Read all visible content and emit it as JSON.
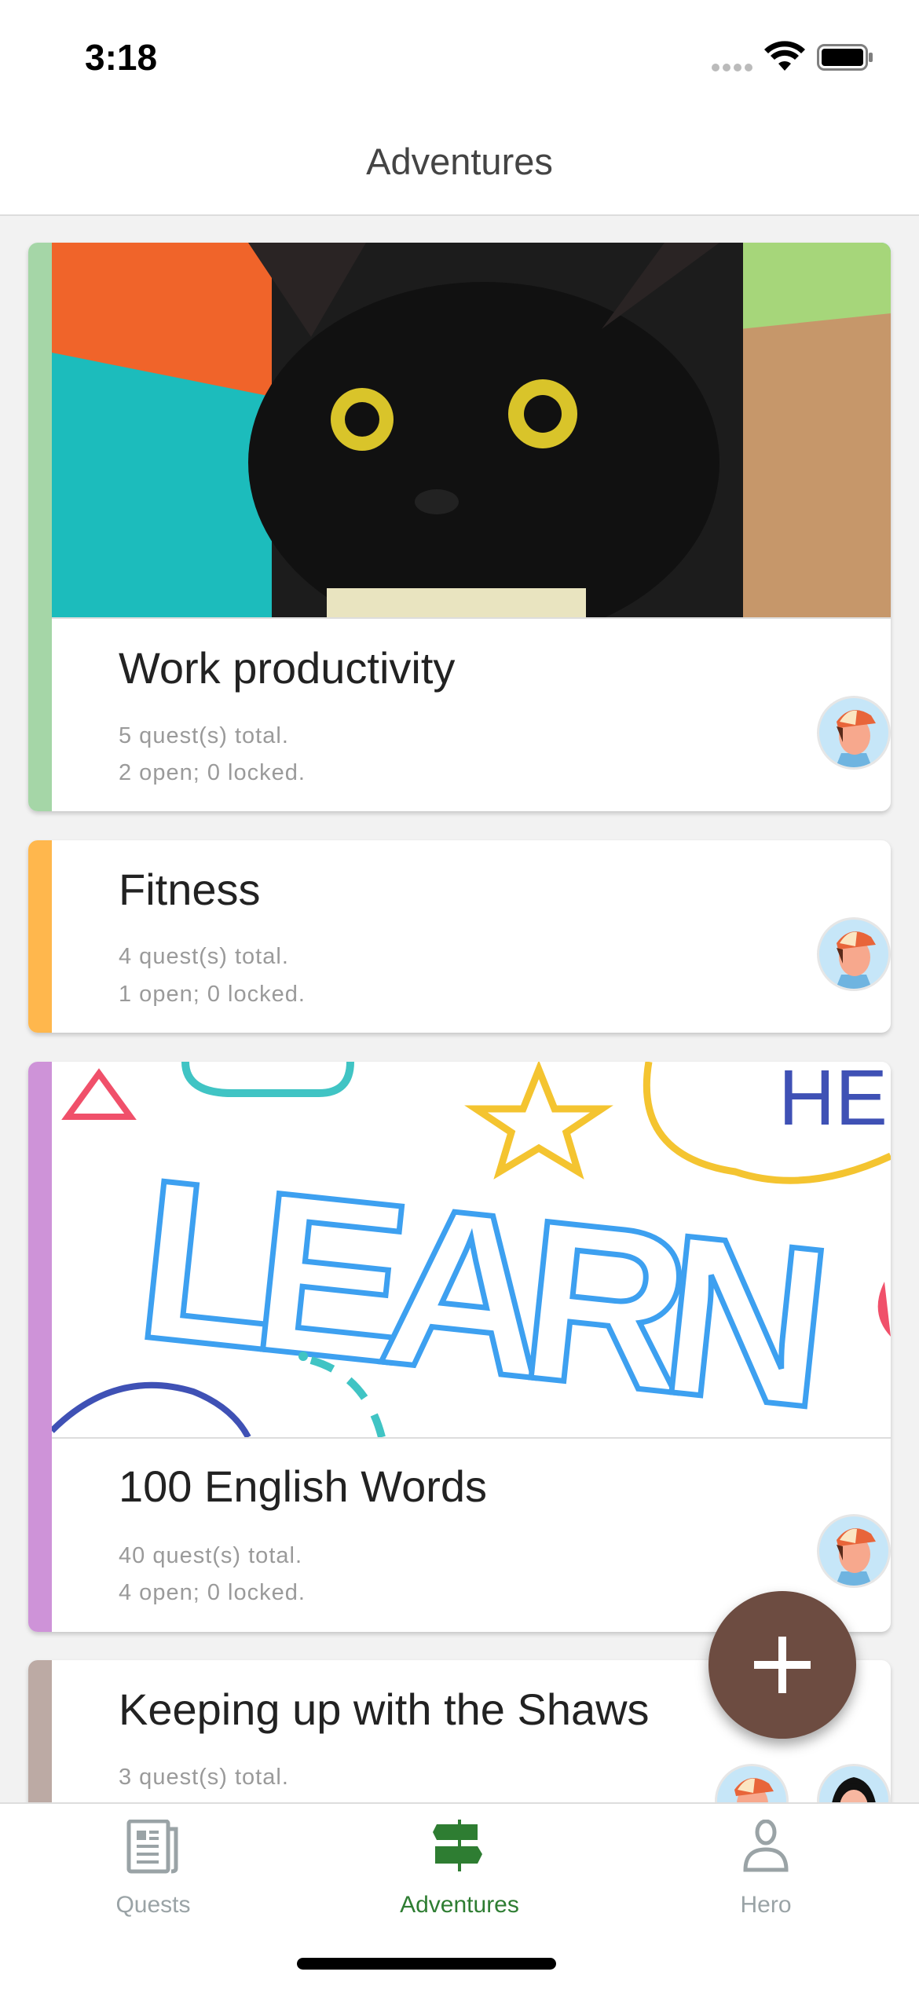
{
  "status_bar": {
    "time": "3:18",
    "icons": [
      "cellular-dots-icon",
      "wifi-icon",
      "battery-icon"
    ]
  },
  "header": {
    "title": "Adventures"
  },
  "adventures": [
    {
      "title": "Work productivity",
      "total": "5 quest(s) total.",
      "status": "2 open; 0 locked.",
      "stripe_color": "#a5d6a7",
      "image": "black-cat",
      "heroes": [
        "boy-cap"
      ]
    },
    {
      "title": "Fitness",
      "total": "4 quest(s) total.",
      "status": "1 open; 0 locked.",
      "stripe_color": "#ffb74d",
      "image": null,
      "heroes": [
        "boy-cap"
      ]
    },
    {
      "title": "100 English Words",
      "total": "40 quest(s) total.",
      "status": "4 open; 0 locked.",
      "stripe_color": "#ce93d8",
      "image": "learn-doodle",
      "image_text": "LEARN",
      "heroes": [
        "boy-cap"
      ]
    },
    {
      "title": "Keeping up with the Shaws",
      "total": "3 quest(s) total.",
      "stripe_color": "#bcaaa4",
      "image": null,
      "heroes": [
        "boy-cap",
        "girl-black-hair"
      ]
    }
  ],
  "fab": {
    "icon": "plus-icon",
    "color": "#6d4c41"
  },
  "tabs": [
    {
      "label": "Quests",
      "icon": "newspaper-icon",
      "active": false
    },
    {
      "label": "Adventures",
      "icon": "signpost-icon",
      "active": true
    },
    {
      "label": "Hero",
      "icon": "person-icon",
      "active": false
    }
  ],
  "colors": {
    "active_tab": "#2e7d32",
    "inactive_tab": "#9aa3a6"
  }
}
